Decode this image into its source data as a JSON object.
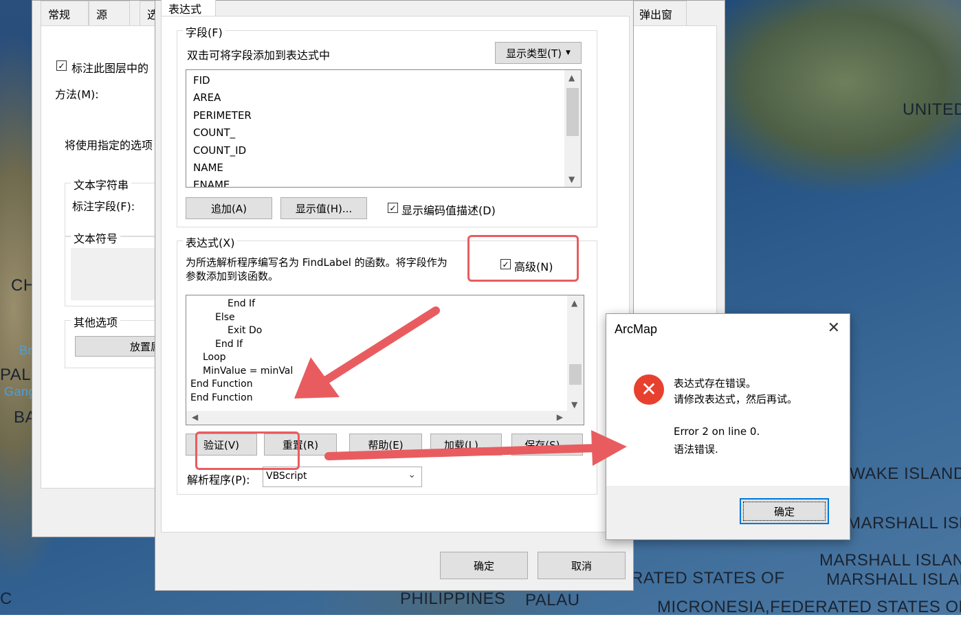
{
  "map": {
    "labels": [
      "UNITED",
      "CH",
      "PAL",
      "BA",
      "Br",
      "Gang",
      "WAKE ISLAND",
      "MARSHALL ISL",
      "MARSHALL ISLAN",
      "MARSHALL ISLAN",
      "RATED STATES OF",
      "PHILIPPINES",
      "PALAU",
      "MICRONESIA,FEDERATED STATES OF",
      "C"
    ]
  },
  "layer_props": {
    "tabs": [
      "常规",
      "源",
      "选"
    ],
    "tab_right": "弹出窗口",
    "label_checkbox": "标注此图层中的",
    "method_label": "方法(M):",
    "desc": "将使用指定的选项",
    "text_string_group": "文本字符串",
    "label_field": "标注字段(F):",
    "text_symbol_group": "文本符号",
    "other_options_group": "其他选项",
    "placement_button": "放置属"
  },
  "expr_dialog": {
    "tab_title": "表达式",
    "fields_group": "字段(F)",
    "fields_hint": "双击可将字段添加到表达式中",
    "show_type_button": "显示类型(T)",
    "fields": [
      "FID",
      "AREA",
      "PERIMETER",
      "COUNT_",
      "COUNT_ID",
      "NAME",
      "ENAME"
    ],
    "append_button": "追加(A)",
    "show_values_button": "显示值(H)...",
    "show_coded_checkbox": "显示编码值描述(D)",
    "expression_group": "表达式(X)",
    "expression_hint_line1": "为所选解析程序编写名为 FindLabel 的函数。将字段作为",
    "expression_hint_line2": "参数添加到该函数。",
    "advanced_checkbox": "高级(N)",
    "code_lines": [
      "End If",
      "Else",
      "Exit Do",
      "End If",
      "Loop",
      "MinValue = minVal",
      "End Function",
      "End Function"
    ],
    "verify_button": "验证(V)",
    "reset_button": "重置(R)",
    "help_button": "帮助(E)",
    "load_button": "加载(L)...",
    "save_button": "保存(S)...",
    "parser_label": "解析程序(P):",
    "parser_value": "VBScript",
    "ok_button": "确定",
    "cancel_button": "取消"
  },
  "error_dialog": {
    "title": "ArcMap",
    "message_line1": "表达式存在错误。",
    "message_line2": "请修改表达式，然后再试。",
    "error_line1": "Error 2 on line 0.",
    "error_line2": "语法错误.",
    "ok_button": "确定"
  },
  "colors": {
    "annotation_red": "#e85c60",
    "error_icon_red": "#e8402f",
    "focus_blue": "#0078d7"
  }
}
